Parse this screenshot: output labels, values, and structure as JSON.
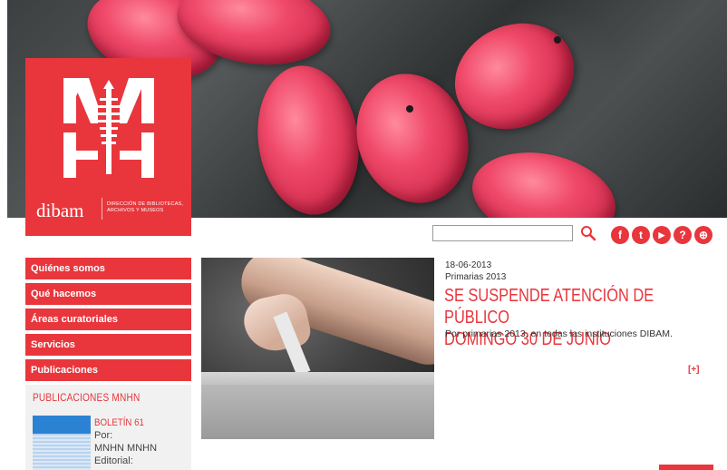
{
  "logo": {
    "mark": "MNHN",
    "brand": "dibam",
    "brand_desc": "DIRECCIÓN DE BIBLIOTECAS, ARCHIVOS Y MUSEOS"
  },
  "search": {
    "placeholder": ""
  },
  "social": [
    {
      "icon": "facebook-icon",
      "glyph": "f"
    },
    {
      "icon": "twitter-icon",
      "glyph": "t"
    },
    {
      "icon": "youtube-icon",
      "glyph": "▶"
    },
    {
      "icon": "help-icon",
      "glyph": "?"
    },
    {
      "icon": "sitemap-icon",
      "glyph": "⊕"
    }
  ],
  "nav": [
    "Quiénes somos",
    "Qué hacemos",
    "Áreas curatoriales",
    "Servicios",
    "Publicaciones"
  ],
  "publications": {
    "title": "PUBLICACIONES MNHN",
    "item_title": "BOLETÍN 61",
    "meta": [
      "Por:",
      "MNHN MNHN",
      "Editorial:"
    ]
  },
  "news": {
    "date": "18-06-2013",
    "category": "Primarias 2013",
    "title_line1": "SE SUSPENDE ATENCIÓN DE PÚBLICO",
    "title_line2": "DOMINGO 30 DE JUNIO",
    "summary": "Por primarias 2013, en todas las instituciones DIBAM.",
    "more": "[+]"
  },
  "colors": {
    "accent": "#e8363c"
  }
}
